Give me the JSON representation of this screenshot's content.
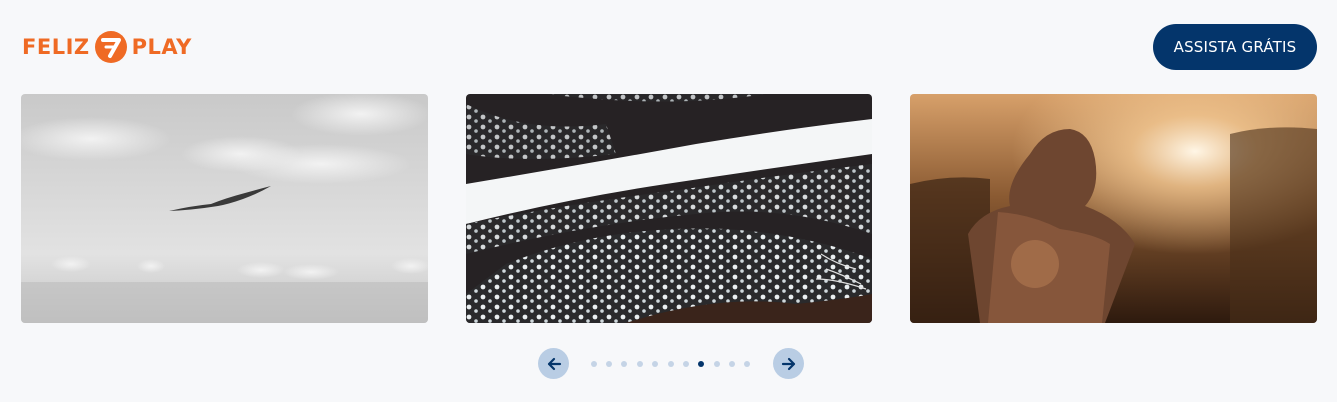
{
  "header": {
    "logo_left": "FELIZ",
    "logo_mark": "7",
    "logo_right": "PLAY",
    "cta_label": "ASSISTA GRÁTIS"
  },
  "colors": {
    "brand_orange": "#ef6a24",
    "brand_navy": "#04356b",
    "page_background": "#f7f8fa",
    "arrow_background": "#b9cde4",
    "dot_inactive": "#c5d4e6"
  },
  "carousel": {
    "slides": [
      {
        "subject": "seagull-over-sea-grayscale"
      },
      {
        "subject": "ocean-waves-aerial"
      },
      {
        "subject": "woman-at-sunset"
      }
    ],
    "pager": {
      "prev_icon": "arrow-left-icon",
      "next_icon": "arrow-right-icon",
      "dot_count": 11,
      "active_index": 7
    }
  }
}
